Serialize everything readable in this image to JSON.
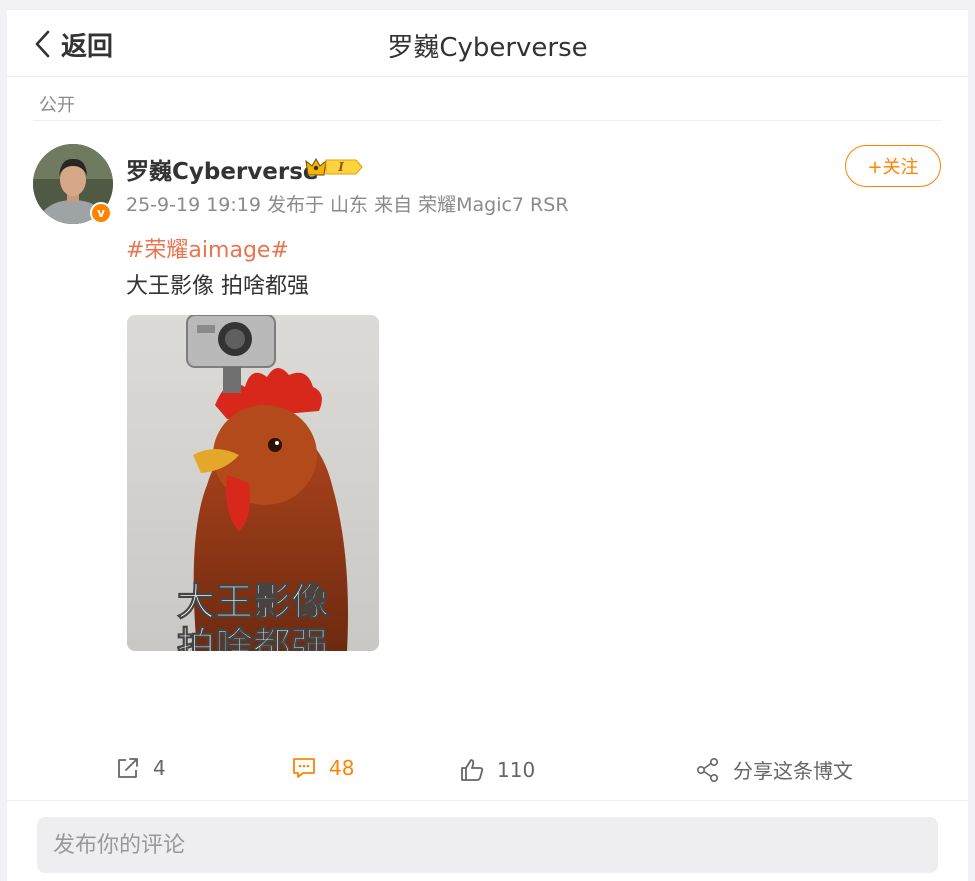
{
  "header": {
    "back_label": "返回",
    "title": "罗巍Cyberverse"
  },
  "post": {
    "visibility": "公开",
    "author": "罗巍Cyberverse",
    "member_badge": "I",
    "meta": "25-9-19 19:19 发布于 山东 来自 荣耀Magic7 RSR",
    "follow_label": "+关注",
    "topic": "#荣耀aimage#",
    "text": "大王影像 拍啥都强",
    "image_caption_line1": "大王影像",
    "image_caption_line2": "拍啥都强"
  },
  "actions": {
    "repost_count": "4",
    "comment_count": "48",
    "like_count": "110",
    "share_label": "分享这条博文"
  },
  "comment_box": {
    "placeholder": "发布你的评论"
  },
  "colors": {
    "accent": "#ff8200",
    "topic": "#eb7350"
  }
}
